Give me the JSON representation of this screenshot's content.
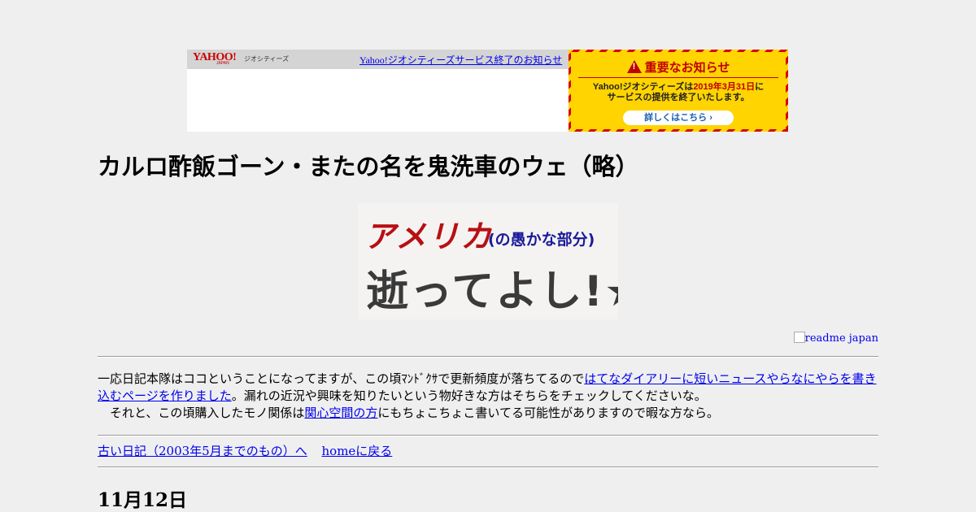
{
  "ad": {
    "yahoo_logo": "YAHOO!",
    "yahoo_sub": "JAPAN",
    "geo_label": "ジオシティーズ",
    "notice_link": "Yahoo!ジオシティーズサービス終了のお知らせ",
    "warning_title": "重要なお知らせ",
    "warning_line1_pre": "Yahoo!ジオシティーズは",
    "warning_line1_date": "2019年3月31日",
    "warning_line1_post": "に",
    "warning_line2": "サービスの提供を終了いたします。",
    "details_button": "詳しくはこちら ›",
    "colors": {
      "stripe_red": "#d60000",
      "stripe_yellow": "#ffd400",
      "bar_gray": "#d4d4d4"
    }
  },
  "site": {
    "title": "カルロ酢飯ゴーン・またの名を鬼洗車のウェ（略）"
  },
  "logo": {
    "line1_red": "アメリカ",
    "line1_small": "(の愚かな部分)",
    "line2": "逝ってよし!★"
  },
  "readme": {
    "alt": "readme japan"
  },
  "intro": {
    "text1": "一応日記本隊はココということになってますが、この頃ﾏﾝﾄﾞｸｻで更新頻度が落ちてるので",
    "link1": "はてなダイアリーに短いニュースやらなにやらを書き込むページを作りました",
    "text2": "。漏れの近況や興味を知りたいという物好きな方はそちらをチェックしてくださいな。",
    "text3": "　それと、この頃購入したモノ関係は",
    "link2": "関心空間の方",
    "text4": "にもちょこちょこ書いてる可能性がありますので暇な方なら。"
  },
  "nav": {
    "old_diary": "古い日記（2003年5月までのもの）へ",
    "home": "homeに戻る"
  },
  "entry": {
    "date": "11月12日"
  }
}
